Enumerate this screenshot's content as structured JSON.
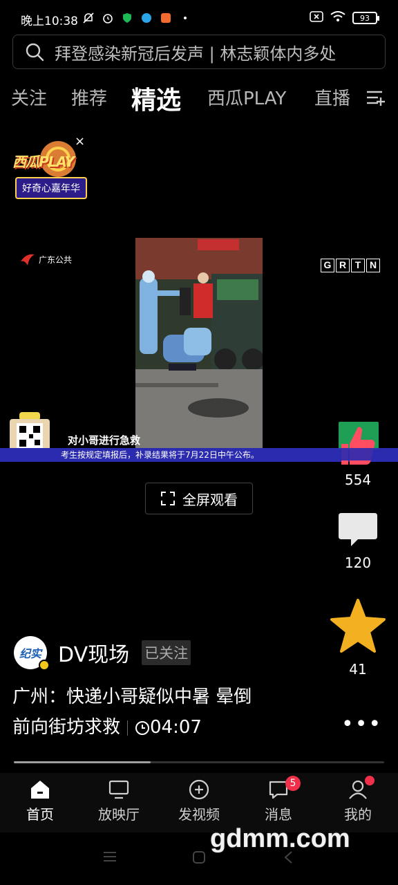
{
  "status_bar": {
    "time": "晚上10:38",
    "battery": "93"
  },
  "search": {
    "text": "拜登感染新冠后发声 | 林志颖体内多处"
  },
  "tabs": [
    {
      "label": "关注"
    },
    {
      "label": "推荐"
    },
    {
      "label": "精选",
      "active": true
    },
    {
      "label": "西瓜PLAY"
    },
    {
      "label": "直播"
    }
  ],
  "promo": {
    "title": "西瓜PLAY",
    "subtitle": "好奇心嘉年华",
    "close": "×"
  },
  "video": {
    "channel_logo": "广东公共",
    "watermark_letters": [
      "G",
      "R",
      "T",
      "N"
    ],
    "subtitle": "对小哥进行急救",
    "ticker": "考生按规定填报后，补录结果将于7月22日中午公布。"
  },
  "fullscreen_label": "全屏观看",
  "actions": {
    "like_count": "554",
    "comment_count": "120",
    "favorite_count": "41",
    "more": "•••"
  },
  "author": {
    "avatar_text": "纪实",
    "name": "DV现场",
    "follow_status": "已关注"
  },
  "post": {
    "title_line1": "广州：快递小哥疑似中暑 晕倒",
    "title_line2": "前向街坊求救",
    "duration": "04:07"
  },
  "progress": 0.37,
  "bottom_nav": [
    {
      "label": "首页",
      "icon": "home-icon",
      "active": true
    },
    {
      "label": "放映厅",
      "icon": "tv-icon"
    },
    {
      "label": "发视频",
      "icon": "plus-circle-icon"
    },
    {
      "label": "消息",
      "icon": "message-icon",
      "badge": "5"
    },
    {
      "label": "我的",
      "icon": "user-icon",
      "dot": true
    }
  ],
  "watermark": "gdmm.com",
  "colors": {
    "background": "#000000",
    "badge_red": "#f0304a",
    "star_gold": "#f3b021",
    "ticker_blue": "#2b2bb0"
  }
}
